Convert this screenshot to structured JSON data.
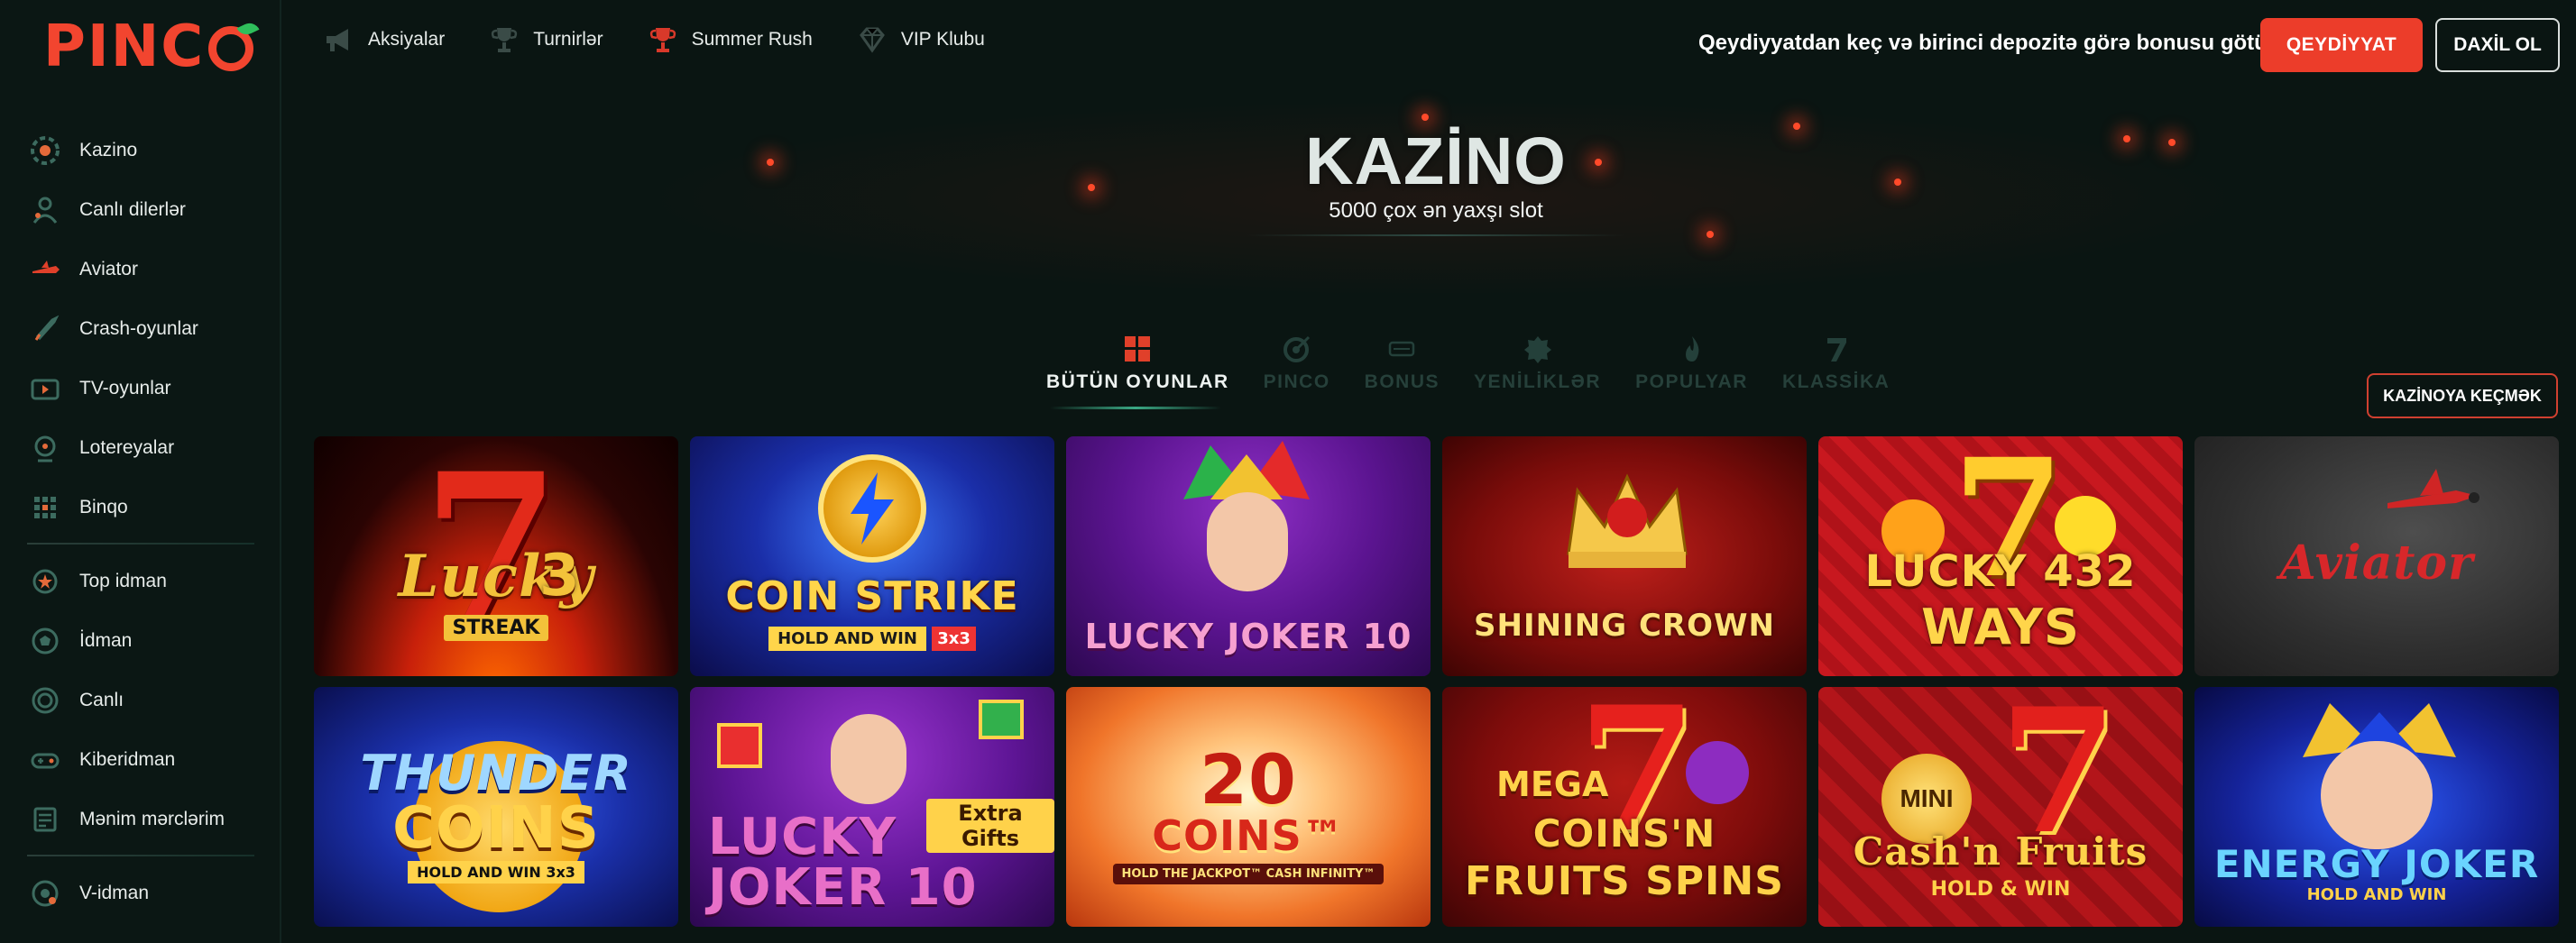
{
  "brand": {
    "logo_text": "PINCO"
  },
  "sidebar": {
    "groups": [
      [
        {
          "label": "Kazino",
          "icon": "casino-chip-icon"
        },
        {
          "label": "Canlı dilerlər",
          "icon": "live-dealer-icon"
        },
        {
          "label": "Aviator",
          "icon": "plane-icon"
        },
        {
          "label": "Crash-oyunlar",
          "icon": "rocket-icon"
        },
        {
          "label": "TV-oyunlar",
          "icon": "tv-icon"
        },
        {
          "label": "Lotereyalar",
          "icon": "lottery-icon"
        },
        {
          "label": "Binqo",
          "icon": "bingo-icon"
        }
      ],
      [
        {
          "label": "Top idman",
          "icon": "sport-star-icon"
        },
        {
          "label": "İdman",
          "icon": "soccer-ball-icon"
        },
        {
          "label": "Canlı",
          "icon": "live-circle-icon"
        },
        {
          "label": "Kiberidman",
          "icon": "gamepad-icon"
        },
        {
          "label": "Mənim mərclərim",
          "icon": "bets-list-icon"
        }
      ],
      [
        {
          "label": "V-idman",
          "icon": "virtual-sport-icon"
        }
      ]
    ]
  },
  "header": {
    "nav": [
      {
        "label": "Aksiyalar",
        "icon": "megaphone-icon"
      },
      {
        "label": "Turnirlər",
        "icon": "trophy-icon"
      },
      {
        "label": "Summer Rush",
        "icon": "red-trophy-icon"
      },
      {
        "label": "VIP Klubu",
        "icon": "diamond-icon"
      }
    ],
    "promo_text": "Qeydiyyatdan keç və birinci depozitə görə bonusu götür",
    "register_label": "QEYDİYYAT",
    "login_label": "DAXİL OL"
  },
  "hero": {
    "title": "KAZİNO",
    "subtitle": "5000 çox ən yaxşı slot"
  },
  "tabs": [
    {
      "label": "BÜTÜN OYUNLAR",
      "icon": "grid-icon",
      "active": true
    },
    {
      "label": "PINCO",
      "icon": "pinco-target-icon",
      "active": false
    },
    {
      "label": "BONUS",
      "icon": "bonus-icon",
      "active": false
    },
    {
      "label": "YENİLİKLƏR",
      "icon": "new-badge-icon",
      "active": false
    },
    {
      "label": "POPULYAR",
      "icon": "flame-icon",
      "active": false
    },
    {
      "label": "KLASSİKA",
      "icon": "seven-icon",
      "active": false
    }
  ],
  "casino_button": "KAZİNOYA KEÇMƏK",
  "games": [
    {
      "name": "Lucky Streak 3",
      "line1": "Lucky",
      "line2": "3",
      "line3": "STREAK"
    },
    {
      "name": "Coin Strike",
      "line1": "COIN STRIKE",
      "line2": "HOLD AND WIN",
      "line3": "3x3"
    },
    {
      "name": "Lucky Joker 10",
      "line1": "LUCKY JOKER 10"
    },
    {
      "name": "Shining Crown",
      "line1": "SHINING CROWN"
    },
    {
      "name": "Lucky 432 Ways",
      "line1": "LUCKY 432",
      "line2": "WAYS"
    },
    {
      "name": "Aviator",
      "line1": "Aviator"
    },
    {
      "name": "Thunder Coins",
      "line1": "THUNDER",
      "line2": "COINS",
      "line3": "HOLD AND WIN 3x3"
    },
    {
      "name": "Lucky Joker 10 Extra Gifts",
      "line1": "LUCKY",
      "line2": "JOKER 10",
      "line3": "Extra Gifts"
    },
    {
      "name": "20 Coins",
      "line1": "20",
      "line2": "COINS™",
      "line3": "HOLD THE JACKPOT™ CASH INFINITY™"
    },
    {
      "name": "Mega 7 Coins'n Fruits Spins",
      "line1": "MEGA",
      "line2": "COINS'N",
      "line3": "FRUITS SPINS"
    },
    {
      "name": "Mini Cash'n Fruits",
      "line1": "MINI",
      "line2": "Cash'n Fruits",
      "line3": "HOLD & WIN"
    },
    {
      "name": "Energy Joker",
      "line1": "ENERGY JOKER",
      "line2": "HOLD AND WIN"
    }
  ]
}
